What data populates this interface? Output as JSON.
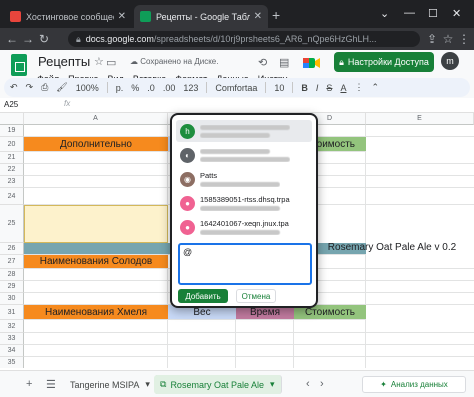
{
  "browser": {
    "tabs": [
      {
        "title": "Хостинговое сообщество «Tim",
        "favicon_color": "#e8453c"
      },
      {
        "title": "Рецепты - Google Таблицы",
        "favicon_color": "#0f9d58"
      }
    ],
    "url_host": "docs.google.com",
    "url_path": "/spreadsheets/d/10rj9prsheets6_AR6_nQpe6HzGhLH..."
  },
  "sheets": {
    "doc_title": "Рецепты",
    "saved_status": "Сохранено на Диске.",
    "menu": [
      "Файл",
      "Правка",
      "Вид",
      "Вставка",
      "Формат",
      "Данные",
      "Инстру"
    ],
    "share_label": "Настройки Доступа",
    "user_initial": "m",
    "toolbar": {
      "zoom": "100%",
      "currency": "р.",
      "percent": "%",
      "decimals_dec": ".0",
      "decimals_inc": ".00",
      "more_formats": "123",
      "font": "Comfortaa",
      "font_size": "10"
    },
    "cell_ref": "A25",
    "formula_icon": "fx"
  },
  "grid": {
    "columns": [
      "A",
      "B",
      "C",
      "D",
      "E"
    ],
    "rows": [
      "19",
      "20",
      "21",
      "22",
      "23",
      "24",
      "25",
      "26",
      "27",
      "28",
      "29",
      "30",
      "31",
      "32",
      "33",
      "34",
      "35"
    ],
    "cells": {
      "r20a": "Дополнительно",
      "r20d": "Стоимость",
      "r26a": "Наименования Солодов",
      "r26d": "Rosemary Oat Pale Ale v 0.2",
      "r32a": "Наименования Хмеля",
      "r32b": "Вес",
      "r32c": "Время",
      "r32d": "Стоимость"
    }
  },
  "mention_popup": {
    "suggestions": [
      {
        "label": "",
        "email": "",
        "avatar_letter": "h",
        "avatar_color": "#1e8e3e"
      },
      {
        "label": "",
        "email": "",
        "avatar_letter": "",
        "avatar_color": "#5f6368"
      },
      {
        "label": "Patts",
        "email": "",
        "avatar_letter": "",
        "avatar_color": "#8d6e63"
      },
      {
        "label": "1585389051-rtss.dhsq.trpa",
        "email": "",
        "avatar_letter": "",
        "avatar_color": "#f06292"
      },
      {
        "label": "1642401067-xeqn.jnux.tpa",
        "email": "",
        "avatar_letter": "",
        "avatar_color": "#f06292"
      }
    ],
    "input_value": "@",
    "add_label": "Добавить",
    "cancel_label": "Отмена"
  },
  "sheet_tabs": {
    "tabs": [
      "Tangerine MSIPA",
      "Rosemary Oat Pale Ale"
    ],
    "active_index": 1,
    "explore_label": "Анализ данных"
  }
}
